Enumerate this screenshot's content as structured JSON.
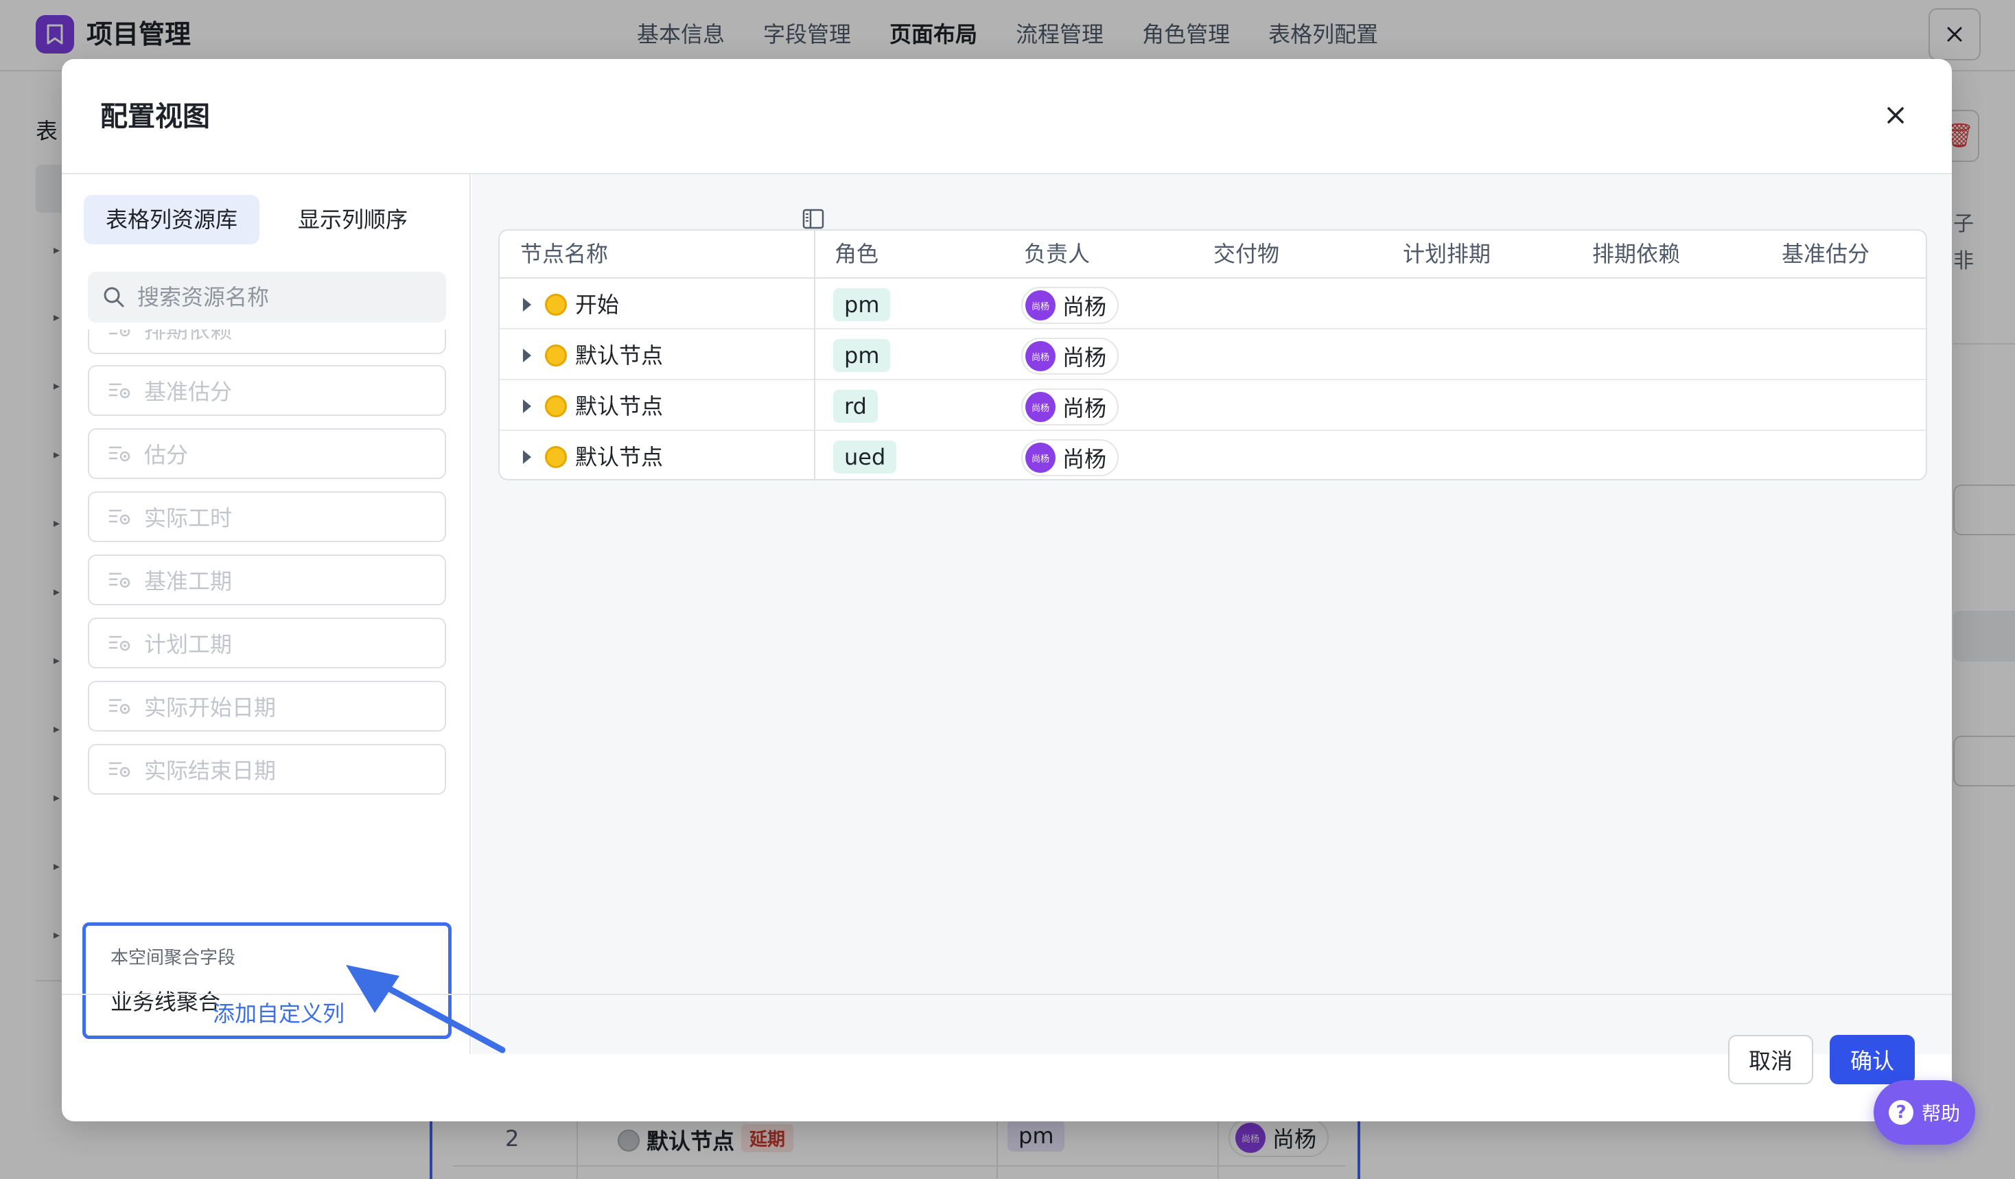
{
  "app": {
    "title": "项目管理"
  },
  "top_tabs": [
    {
      "label": "基本信息"
    },
    {
      "label": "字段管理"
    },
    {
      "label": "页面布局",
      "active": true
    },
    {
      "label": "流程管理"
    },
    {
      "label": "角色管理"
    },
    {
      "label": "表格列配置"
    }
  ],
  "background": {
    "left_title": "表",
    "right_text": "子\n非",
    "row": {
      "index": "2",
      "name": "默认节点",
      "tag": "延期",
      "role": "pm",
      "owner": "尚杨",
      "avatar_text": "尚杨"
    }
  },
  "modal": {
    "title": "配置视图",
    "tabs": [
      {
        "label": "表格列资源库",
        "active": true
      },
      {
        "label": "显示列顺序"
      }
    ],
    "search_placeholder": "搜索资源名称",
    "field_items": [
      {
        "label": "排期依赖"
      },
      {
        "label": "基准估分"
      },
      {
        "label": "估分"
      },
      {
        "label": "实际工时"
      },
      {
        "label": "基准工期"
      },
      {
        "label": "计划工期"
      },
      {
        "label": "实际开始日期"
      },
      {
        "label": "实际结束日期"
      }
    ],
    "aggregate": {
      "caption": "本空间聚合字段",
      "value": "业务线聚合"
    },
    "add_custom_label": "添加自定义列",
    "grid": {
      "columns": [
        "节点名称",
        "角色",
        "负责人",
        "交付物",
        "计划排期",
        "排期依赖",
        "基准估分"
      ],
      "rows": [
        {
          "name": "开始",
          "role": "pm",
          "owner": "尚杨",
          "avatar_text": "尚杨"
        },
        {
          "name": "默认节点",
          "role": "pm",
          "owner": "尚杨",
          "avatar_text": "尚杨"
        },
        {
          "name": "默认节点",
          "role": "rd",
          "owner": "尚杨",
          "avatar_text": "尚杨"
        },
        {
          "name": "默认节点",
          "role": "ued",
          "owner": "尚杨",
          "avatar_text": "尚杨"
        }
      ]
    },
    "cancel_label": "取消",
    "confirm_label": "确认"
  },
  "help": {
    "label": "帮助",
    "icon": "?"
  },
  "icons": {
    "app_logo": "bookmark-icon",
    "close": "close-icon",
    "search": "search-icon",
    "field": "field-settings-icon",
    "sidebar_toggle": "sidebar-toggle-icon",
    "expand": "caret-right-icon",
    "trash": "trash-icon",
    "help": "help-icon"
  },
  "colors": {
    "accent": "#3152e8",
    "link": "#3c6fe6",
    "brand": "#7b3ee6",
    "status_dot": "#f6c21b",
    "role_tag_bg": "#dff3ef",
    "help_bg": "#7b5cf0"
  }
}
